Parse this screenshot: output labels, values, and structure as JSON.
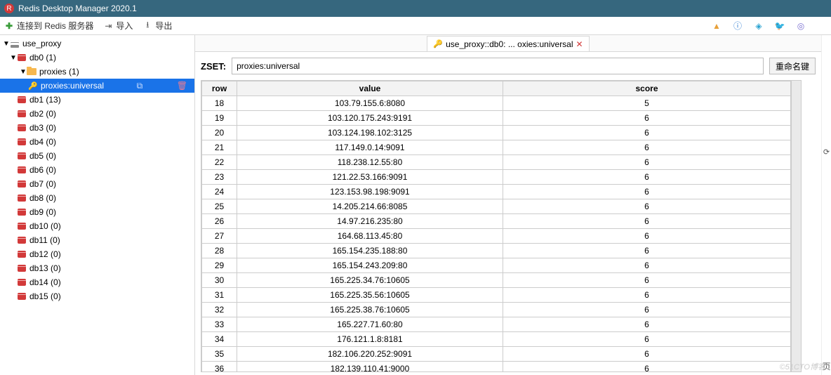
{
  "titlebar": {
    "title": "Redis Desktop Manager 2020.1"
  },
  "toolbar": {
    "connect": "连接到 Redis 服务器",
    "import": "导入",
    "export": "导出"
  },
  "sidebar": {
    "server": {
      "label": "use_proxy"
    },
    "db0": {
      "label": "db0 (1)"
    },
    "folder": {
      "label": "proxies (1)"
    },
    "selected_key": {
      "label": "proxies:universal"
    },
    "dbs": [
      {
        "label": "db1  (13)"
      },
      {
        "label": "db2  (0)"
      },
      {
        "label": "db3  (0)"
      },
      {
        "label": "db4  (0)"
      },
      {
        "label": "db5  (0)"
      },
      {
        "label": "db6  (0)"
      },
      {
        "label": "db7  (0)"
      },
      {
        "label": "db8  (0)"
      },
      {
        "label": "db9  (0)"
      },
      {
        "label": "db10  (0)"
      },
      {
        "label": "db11  (0)"
      },
      {
        "label": "db12  (0)"
      },
      {
        "label": "db13  (0)"
      },
      {
        "label": "db14  (0)"
      },
      {
        "label": "db15  (0)"
      }
    ]
  },
  "tab": {
    "label": "use_proxy::db0: ... oxies:universal"
  },
  "key": {
    "type": "ZSET:",
    "name": "proxies:universal",
    "rename": "重命名键"
  },
  "table": {
    "headers": {
      "row": "row",
      "value": "value",
      "score": "score"
    },
    "rows": [
      {
        "row": "18",
        "value": "103.79.155.6:8080",
        "score": "5"
      },
      {
        "row": "19",
        "value": "103.120.175.243:9191",
        "score": "6"
      },
      {
        "row": "20",
        "value": "103.124.198.102:3125",
        "score": "6"
      },
      {
        "row": "21",
        "value": "117.149.0.14:9091",
        "score": "6"
      },
      {
        "row": "22",
        "value": "118.238.12.55:80",
        "score": "6"
      },
      {
        "row": "23",
        "value": "121.22.53.166:9091",
        "score": "6"
      },
      {
        "row": "24",
        "value": "123.153.98.198:9091",
        "score": "6"
      },
      {
        "row": "25",
        "value": "14.205.214.66:8085",
        "score": "6"
      },
      {
        "row": "26",
        "value": "14.97.216.235:80",
        "score": "6"
      },
      {
        "row": "27",
        "value": "164.68.113.45:80",
        "score": "6"
      },
      {
        "row": "28",
        "value": "165.154.235.188:80",
        "score": "6"
      },
      {
        "row": "29",
        "value": "165.154.243.209:80",
        "score": "6"
      },
      {
        "row": "30",
        "value": "165.225.34.76:10605",
        "score": "6"
      },
      {
        "row": "31",
        "value": "165.225.35.56:10605",
        "score": "6"
      },
      {
        "row": "32",
        "value": "165.225.38.76:10605",
        "score": "6"
      },
      {
        "row": "33",
        "value": "165.227.71.60:80",
        "score": "6"
      },
      {
        "row": "34",
        "value": "176.121.1.8:8181",
        "score": "6"
      },
      {
        "row": "35",
        "value": "182.106.220.252:9091",
        "score": "6"
      },
      {
        "row": "36",
        "value": "182.139.110.41:9000",
        "score": "6"
      }
    ]
  },
  "rightrail": {
    "refresh_hint": "页"
  },
  "watermark": "©51CTO博客"
}
